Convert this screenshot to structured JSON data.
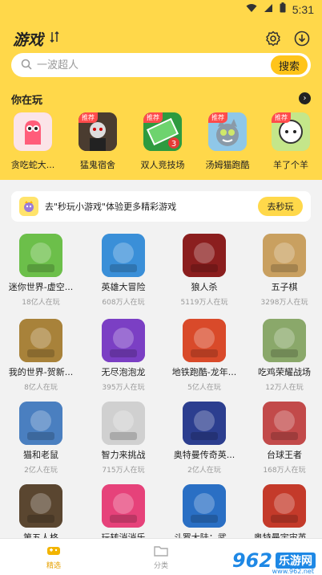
{
  "status": {
    "time": "5:31"
  },
  "header": {
    "title": "游戏",
    "search_placeholder": "一波超人",
    "search_button": "搜索"
  },
  "recent": {
    "title": "你在玩",
    "tag": "推荐",
    "items": [
      {
        "label": "贪吃蛇大...",
        "color": "#ff5d7a",
        "tagged": false
      },
      {
        "label": "猛鬼宿舍",
        "color": "#5a4a3a",
        "tagged": true
      },
      {
        "label": "双人竞技场",
        "color": "#3cb44b",
        "tagged": true
      },
      {
        "label": "汤姆猫跑酷",
        "color": "#8fc7e8",
        "tagged": true
      },
      {
        "label": "羊了个羊",
        "color": "#b7e07a",
        "tagged": true
      }
    ]
  },
  "promo": {
    "text": "去\"秒玩小游戏\"体验更多精彩游戏",
    "button": "去秒玩"
  },
  "games": [
    {
      "name": "迷你世界-虚空...",
      "count": "18亿人在玩",
      "color": "#6cbf4a"
    },
    {
      "name": "英雄大冒险",
      "count": "608万人在玩",
      "color": "#3a8fd8"
    },
    {
      "name": "狼人杀",
      "count": "5119万人在玩",
      "color": "#8b1e1e"
    },
    {
      "name": "五子棋",
      "count": "3298万人在玩",
      "color": "#c9a060"
    },
    {
      "name": "我的世界-贺新...",
      "count": "8亿人在玩",
      "color": "#a8823a"
    },
    {
      "name": "无尽泡泡龙",
      "count": "395万人在玩",
      "color": "#7b3fc4"
    },
    {
      "name": "地铁跑酷-龙年...",
      "count": "5亿人在玩",
      "color": "#d94a2a"
    },
    {
      "name": "吃鸡荣耀战场",
      "count": "12万人在玩",
      "color": "#8aa86a"
    },
    {
      "name": "猫和老鼠",
      "count": "2亿人在玩",
      "color": "#4a7fc0"
    },
    {
      "name": "智力来挑战",
      "count": "715万人在玩",
      "color": "#d0d0d0"
    },
    {
      "name": "奥特曼传奇英...",
      "count": "2亿人在玩",
      "color": "#2c3e8f"
    },
    {
      "name": "台球王者",
      "count": "168万人在玩",
      "color": "#c24a4a"
    },
    {
      "name": "第五人格",
      "count": "",
      "color": "#5a4630"
    },
    {
      "name": "玩转消消乐",
      "count": "",
      "color": "#e6427a"
    },
    {
      "name": "斗罗大陆：武...",
      "count": "",
      "color": "#2a6fc4"
    },
    {
      "name": "奥特曼宇宙英...",
      "count": "",
      "color": "#c43a2a"
    }
  ],
  "tabs": [
    {
      "label": "精选"
    },
    {
      "label": "分类"
    },
    {
      "label": ""
    }
  ],
  "watermark": {
    "logo": "962",
    "text": "乐游网",
    "url": "www.962.net"
  }
}
